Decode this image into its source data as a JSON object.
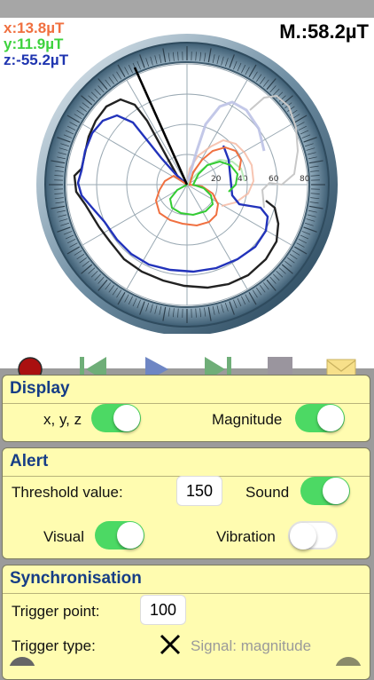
{
  "readouts": {
    "x": "x:13.8µT",
    "y": "y:11.9µT",
    "z": "z:-55.2µT",
    "magnitude": "M.:58.2µT"
  },
  "colors": {
    "x": "#f07040",
    "y": "#3dd23d",
    "z": "#1f35b0",
    "magnitude": "#000000",
    "panel_bg": "#fffcb0",
    "panel_title": "#163d86",
    "toggle_on": "#4cd964"
  },
  "polar_ticks": [
    "20",
    "40",
    "60",
    "80"
  ],
  "toolbar": {
    "record_icon": "record-icon",
    "skip_back_icon": "skip-back-icon",
    "play_icon": "play-icon",
    "skip_forward_icon": "skip-forward-icon",
    "stop_icon": "stop-icon",
    "mail_icon": "mail-icon"
  },
  "display": {
    "title": "Display",
    "xyz_label": "x, y, z",
    "xyz_on": true,
    "magnitude_label": "Magnitude",
    "magnitude_on": true
  },
  "alert": {
    "title": "Alert",
    "threshold_label": "Threshold value:",
    "threshold_value": "150",
    "sound_label": "Sound",
    "sound_on": true,
    "visual_label": "Visual",
    "visual_on": true,
    "vibration_label": "Vibration",
    "vibration_on": false
  },
  "sync": {
    "title": "Synchronisation",
    "trigger_point_label": "Trigger point:",
    "trigger_point_value": "100",
    "trigger_type_label": "Trigger type:",
    "signal_label": "Signal: magnitude"
  }
}
